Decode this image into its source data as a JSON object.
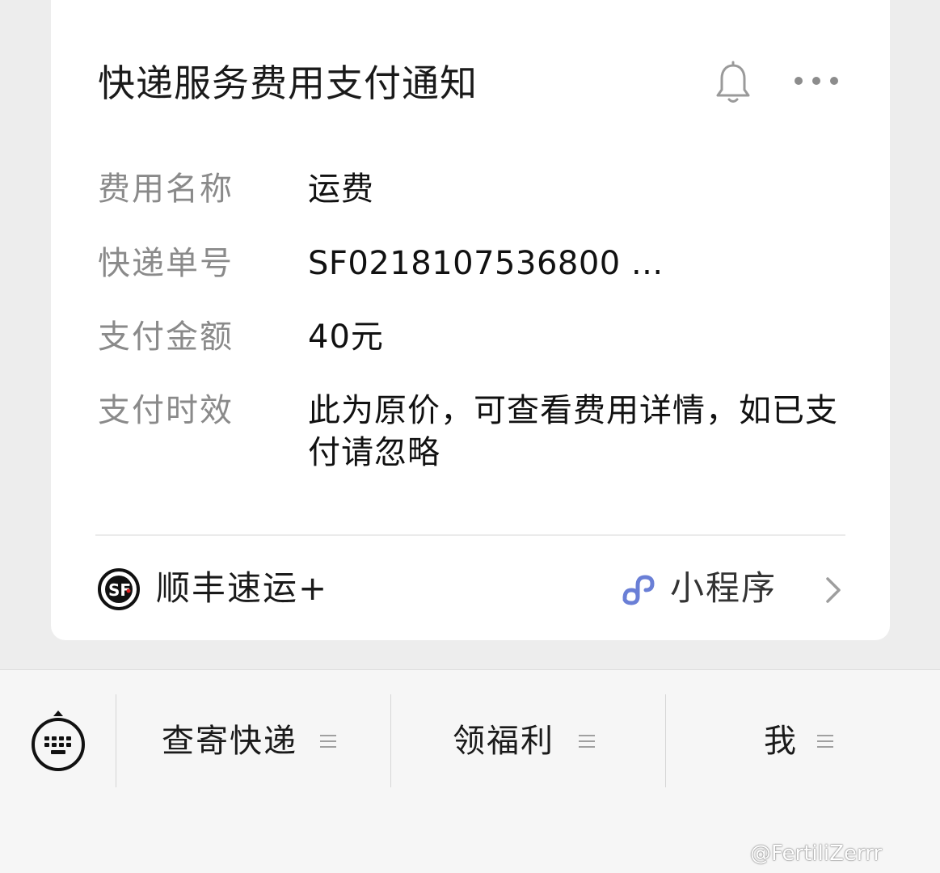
{
  "card": {
    "title": "快递服务费用支付通知",
    "rows": [
      {
        "label": "费用名称",
        "value": "运费"
      },
      {
        "label": "快递单号",
        "value": "SF0218107536800 ..."
      },
      {
        "label": "支付金额",
        "value": "40元"
      },
      {
        "label": "支付时效",
        "value": "此为原价，可查看费用详情，如已支付请忽略"
      }
    ],
    "footer": {
      "brand": "顺丰速运+",
      "mini_program": "小程序"
    }
  },
  "bottom_menu": {
    "items": [
      {
        "label": "查寄快递"
      },
      {
        "label": "领福利"
      },
      {
        "label": "我"
      }
    ]
  },
  "watermark": "@FertiliZerrr",
  "colors": {
    "accent_link": "#6a7fd6",
    "sf_red": "#e02020"
  }
}
